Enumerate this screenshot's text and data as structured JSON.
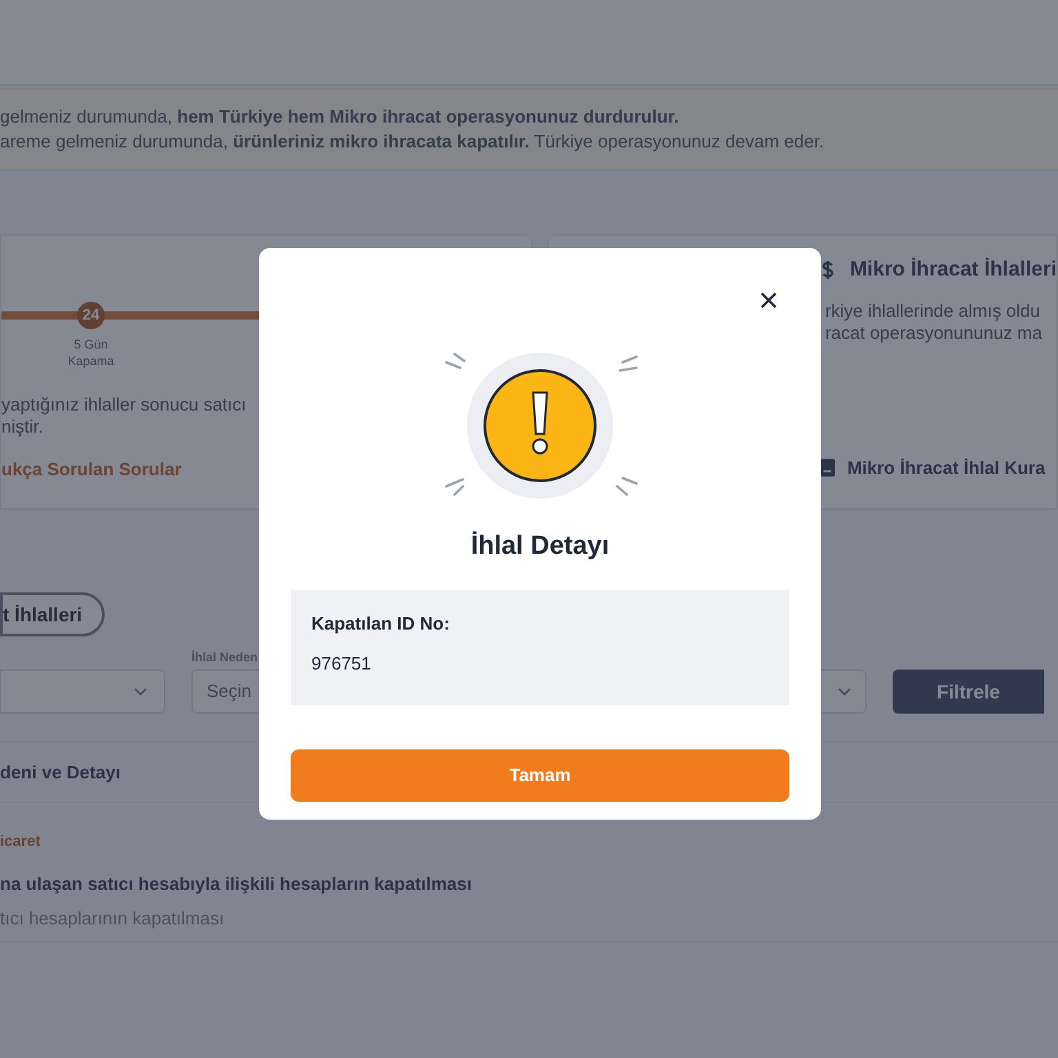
{
  "notice": {
    "lines": [
      "gelmeniz durumunda, **hem Türkiye hem Mikro ihracat operasyonunuz durdurulur.**",
      "areme gelmeniz durumunda, **ürünleriniz mikro ihracata kapatılır.** Türkiye operasyonunuz devam eder."
    ]
  },
  "timeline_card": {
    "steps": [
      {
        "number": "24",
        "label": "5 Gün Kapama"
      }
    ],
    "text_lines": [
      "yaptığınız ihlaller sonucu satıcı",
      "niştir."
    ],
    "link": "ukça Sorulan Sorular"
  },
  "micro_export_card": {
    "title": "Mikro İhracat İhlalleri",
    "text_lines": [
      "rkiye ihlallerinde almış oldu",
      "racat operasyonununuz ma"
    ],
    "link": "Mikro İhracat İhlal Kura"
  },
  "tabs": [
    {
      "label": "t İhlalleri",
      "selected": true
    }
  ],
  "filters": {
    "reason_label": "İhlal Neden",
    "reason_placeholder": "Seçin",
    "button": "Filtrele"
  },
  "table": {
    "header": "deni ve Detayı",
    "rows": [
      {
        "category": "icaret",
        "title": "na ulaşan satıcı hesabıyla ilişkili hesapların kapatılması",
        "detail": "tıcı hesaplarının kapatılması"
      }
    ]
  },
  "modal": {
    "title": "İhlal Detayı",
    "field_label": "Kapatılan ID No:",
    "field_value": "976751",
    "button": "Tamam"
  }
}
